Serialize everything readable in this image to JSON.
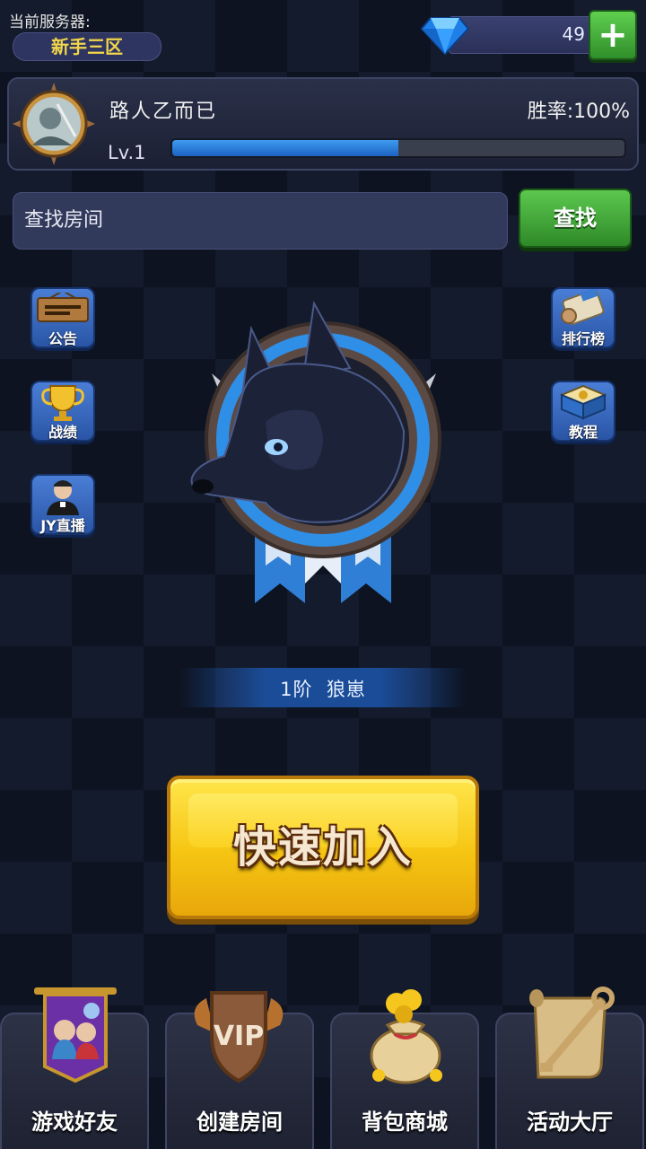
{
  "server": {
    "label": "当前服务器:",
    "name": "新手三区"
  },
  "currency": {
    "gems": "49",
    "add_label": "+"
  },
  "profile": {
    "name": "路人乙而已",
    "win_rate": "胜率:100%",
    "level": "Lv.1",
    "xp_progress": 0.5
  },
  "search": {
    "placeholder": "查找房间",
    "button": "查找"
  },
  "side_left": [
    {
      "label": "公告",
      "icon": "notice-board-icon"
    },
    {
      "label": "战绩",
      "icon": "trophy-icon"
    },
    {
      "label": "JY直播",
      "icon": "streamer-icon"
    }
  ],
  "side_right": [
    {
      "label": "排行榜",
      "icon": "scroll-icon"
    },
    {
      "label": "教程",
      "icon": "book-icon"
    }
  ],
  "rank": {
    "title": "1阶  狼崽"
  },
  "quick_join": {
    "label": "快速加入"
  },
  "bottom_nav": [
    {
      "label": "游戏好友",
      "icon": "friends-banner-icon"
    },
    {
      "label": "创建房间",
      "icon": "vip-shield-icon"
    },
    {
      "label": "背包商城",
      "icon": "gold-bag-icon"
    },
    {
      "label": "活动大厅",
      "icon": "key-scroll-icon"
    }
  ],
  "colors": {
    "accent": "#f5c412",
    "xp": "#2f7fe0",
    "gold_text": "#f3d64a"
  }
}
